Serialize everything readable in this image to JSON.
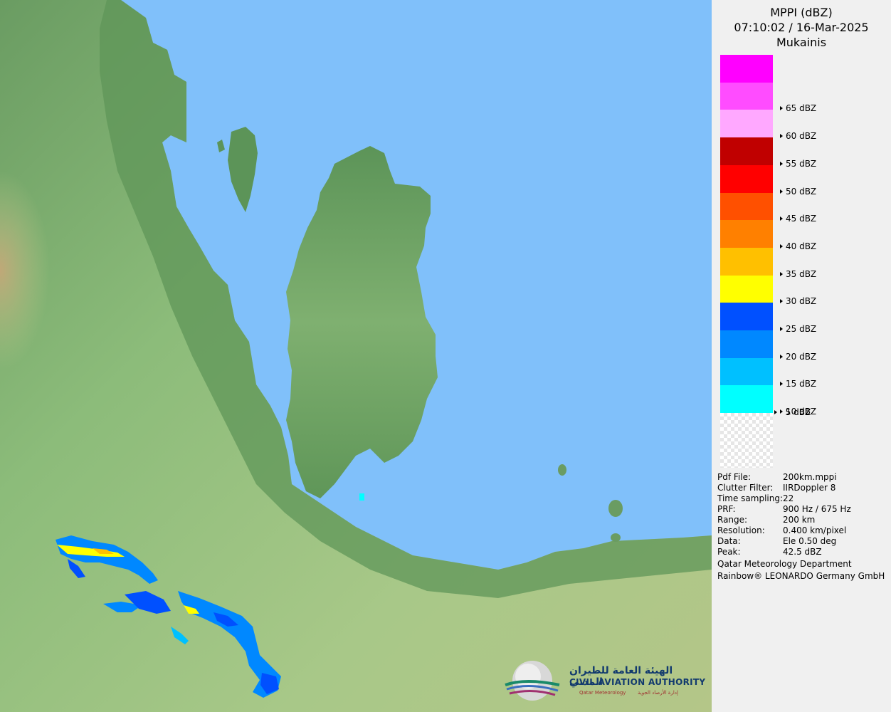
{
  "header": {
    "product": "MPPI (dBZ)",
    "datetime": "07:10:02 / 16-Mar-2025",
    "site": "Mukainis"
  },
  "scale": {
    "items": [
      {
        "color": "#ff00ff",
        "label": ""
      },
      {
        "color": "#ff4cff",
        "label": "65 dBZ"
      },
      {
        "color": "#ffa8ff",
        "label": "60 dBZ"
      },
      {
        "color": "#c00000",
        "label": "55 dBZ"
      },
      {
        "color": "#ff0000",
        "label": "50 dBZ"
      },
      {
        "color": "#ff5000",
        "label": "45 dBZ"
      },
      {
        "color": "#ff8000",
        "label": "40 dBZ"
      },
      {
        "color": "#ffc000",
        "label": "35 dBZ"
      },
      {
        "color": "#ffff00",
        "label": "30 dBZ"
      },
      {
        "color": "#0050ff",
        "label": "25 dBZ"
      },
      {
        "color": "#0088ff",
        "label": "20 dBZ"
      },
      {
        "color": "#00c0ff",
        "label": "15 dBZ"
      },
      {
        "color": "#00ffff",
        "label": "10 dBZ"
      }
    ],
    "bottom_label": "5 dBZ"
  },
  "meta": [
    {
      "key": "Pdf File:",
      "value": "200km.mppi"
    },
    {
      "key": "Clutter Filter:",
      "value": "IIRDoppler 8"
    },
    {
      "key": "Time sampling:",
      "value": "22"
    },
    {
      "key": "PRF:",
      "value": "900 Hz / 675 Hz"
    },
    {
      "key": "Range:",
      "value": "200 km"
    },
    {
      "key": "Resolution:",
      "value": "0.400 km/pixel"
    },
    {
      "key": "Data:",
      "value": "Ele 0.50 deg"
    },
    {
      "key": "Peak:",
      "value": "42.5 dBZ"
    }
  ],
  "footer": {
    "line1": "Qatar Meteorology Department",
    "line2": "Rainbow® LEONARDO Germany GmbH"
  },
  "logo": {
    "arabic_name": "الهيئة العامة للطيران المدني",
    "english_name": "CIVIL AVIATION AUTHORITY",
    "sub_en": "Qatar Meteorology",
    "sub_ar": "إدارة الأرصاد الجوية"
  },
  "colors": {
    "sea": "#80c0fa",
    "land_dark": "#5c9458",
    "land_mid": "#88b878",
    "land_light": "#b8c888",
    "desert": "#c0a878"
  }
}
